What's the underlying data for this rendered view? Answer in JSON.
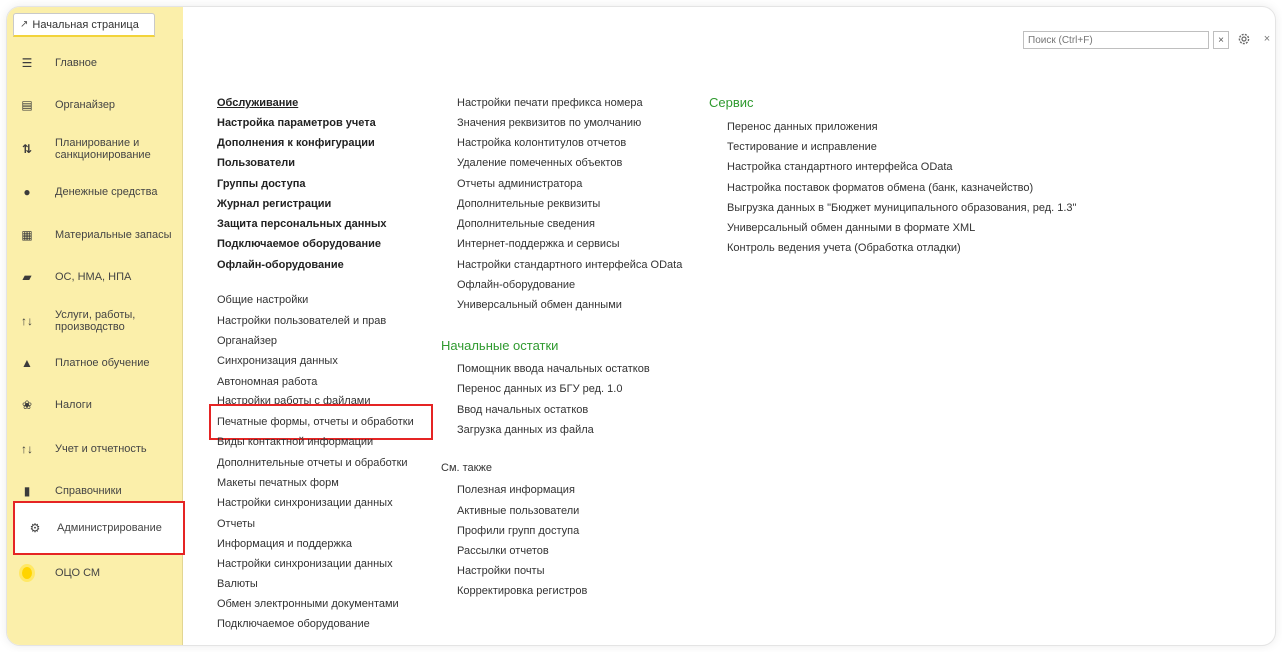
{
  "tab": {
    "home_label": "Начальная страница"
  },
  "sidebar": {
    "items": [
      {
        "label": "Главное",
        "icon": "menu-lines-icon"
      },
      {
        "label": "Органайзер",
        "icon": "notepad-icon"
      },
      {
        "label": "Планирование и санкционирование",
        "icon": "planning-icon"
      },
      {
        "label": "Денежные средства",
        "icon": "money-icon"
      },
      {
        "label": "Материальные запасы",
        "icon": "inventory-icon"
      },
      {
        "label": "ОС, НМА, НПА",
        "icon": "truck-icon"
      },
      {
        "label": "Услуги, работы, производство",
        "icon": "tools-icon"
      },
      {
        "label": "Платное обучение",
        "icon": "graduation-cap-icon"
      },
      {
        "label": "Налоги",
        "icon": "emblem-icon"
      },
      {
        "label": "Учет и отчетность",
        "icon": "accounting-icon"
      },
      {
        "label": "Справочники",
        "icon": "books-icon"
      },
      {
        "label": "Администрирование",
        "icon": "gear-icon"
      },
      {
        "label": "ОЦО СМ",
        "icon": "coin-icon"
      }
    ]
  },
  "search": {
    "placeholder": "Поиск (Ctrl+F)",
    "clear": "×"
  },
  "window": {
    "close": "×"
  },
  "col1": {
    "bold_items": [
      "Обслуживание",
      "Настройка параметров учета",
      "Дополнения к конфигурации",
      "Пользователи",
      "Группы доступа",
      "Журнал регистрации",
      "Защита персональных данных",
      "Подключаемое оборудование",
      "Офлайн-оборудование"
    ],
    "items": [
      "Общие настройки",
      "Настройки пользователей и прав",
      "Органайзер",
      "Синхронизация данных",
      "Автономная работа",
      "Настройки работы с файлами",
      "Печатные формы, отчеты и обработки",
      "Виды контактной информации",
      "Дополнительные отчеты и обработки",
      "Макеты печатных форм",
      "Настройки синхронизации данных",
      "Отчеты",
      "Информация и поддержка",
      "Настройки синхронизации данных",
      "Валюты",
      "Обмен электронными документами",
      "Подключаемое оборудование"
    ]
  },
  "col2": {
    "items": [
      "Настройки печати префикса номера",
      "Значения реквизитов по умолчанию",
      "Настройка колонтитулов отчетов",
      "Удаление помеченных объектов",
      "Отчеты администратора",
      "Дополнительные реквизиты",
      "Дополнительные сведения",
      "Интернет-поддержка и сервисы",
      "Настройки стандартного интерфейса OData",
      "Офлайн-оборудование",
      "Универсальный обмен данными"
    ],
    "opening_title": "Начальные остатки",
    "opening_items": [
      "Помощник ввода начальных остатков",
      "Перенос данных из БГУ ред. 1.0",
      "Ввод начальных остатков",
      "Загрузка данных из файла"
    ],
    "see_also_title": "См. также",
    "see_also_items": [
      "Полезная информация",
      "Активные пользователи",
      "Профили групп доступа",
      "Рассылки отчетов",
      "Настройки почты",
      "Корректировка регистров"
    ]
  },
  "col3": {
    "title": "Сервис",
    "items": [
      "Перенос данных приложения",
      "Тестирование и исправление",
      "Настройка стандартного интерфейса OData",
      "Настройка поставок форматов обмена (банк, казначейство)",
      "Выгрузка данных в \"Бюджет муниципального образования, ред. 1.3\"",
      "Универсальный обмен данными в формате XML",
      "Контроль ведения учета (Обработка отладки)"
    ]
  },
  "colors": {
    "sidebar_bg": "#fbefaa",
    "highlight": "#e52424",
    "group_title": "#2f9a2f"
  }
}
